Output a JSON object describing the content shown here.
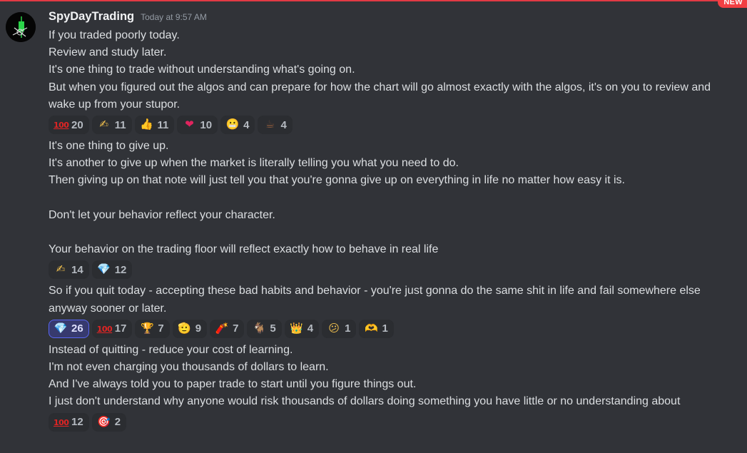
{
  "message": {
    "username": "SpyDayTrading",
    "timestamp": "Today at 9:57 AM",
    "new_badge": "NEW",
    "groups": [
      {
        "lines": [
          "If you traded poorly today.",
          "Review and study later.",
          "It's one thing to trade without understanding what's going on.",
          "But when you figured out the algos and can prepare for how the chart will go almost exactly with the algos, it's on you to review and wake up from your stupor."
        ],
        "reactions": [
          {
            "emoji": "100-icon",
            "count": "20"
          },
          {
            "emoji": "writing-hand-icon",
            "count": "11"
          },
          {
            "emoji": "thumbs-up-icon",
            "count": "11"
          },
          {
            "emoji": "heart-icon",
            "count": "10"
          },
          {
            "emoji": "grimacing-face-icon",
            "count": "4"
          },
          {
            "emoji": "coffee-icon",
            "count": "4"
          }
        ]
      },
      {
        "lines": [
          "It's one thing to give up.",
          "It's another to give up when the market is literally telling you what you need to do.",
          "Then giving up on that note will just tell you that you're gonna give up on everything in life no matter how easy it is.",
          "",
          "Don't let your behavior reflect your character.",
          "",
          "Your behavior on the trading floor will reflect exactly how to behave in real life"
        ],
        "reactions": [
          {
            "emoji": "writing-hand-icon",
            "count": "14"
          },
          {
            "emoji": "gem-icon",
            "count": "12"
          }
        ]
      },
      {
        "lines": [
          "So if you quit today - accepting these bad habits and behavior - you're just gonna do the same shit in life and fail somewhere else anyway sooner or later."
        ],
        "reactions": [
          {
            "emoji": "gem-icon",
            "count": "26",
            "active": true
          },
          {
            "emoji": "100-icon",
            "count": "17"
          },
          {
            "emoji": "trophy-icon",
            "count": "7"
          },
          {
            "emoji": "face-icon",
            "count": "9"
          },
          {
            "emoji": "firecracker-icon",
            "count": "7"
          },
          {
            "emoji": "goat-icon",
            "count": "5"
          },
          {
            "emoji": "crown-icon",
            "count": "4"
          },
          {
            "emoji": "confused-face-icon",
            "count": "1"
          },
          {
            "emoji": "heart-hands-icon",
            "count": "1"
          }
        ]
      },
      {
        "lines": [
          "Instead of quitting - reduce your cost of learning.",
          "I'm not even charging you thousands of dollars to learn.",
          "And I've always told you to paper trade to start until you figure things out.",
          "I just don't understand why anyone would risk thousands of dollars doing something you have little or no understanding about"
        ],
        "reactions": [
          {
            "emoji": "100-icon",
            "count": "12"
          },
          {
            "emoji": "direct-hit-icon",
            "count": "2"
          }
        ]
      }
    ]
  }
}
